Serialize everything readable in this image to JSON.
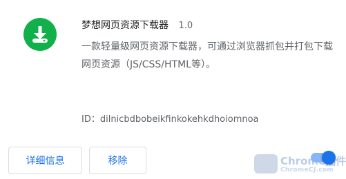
{
  "extension": {
    "name": "梦想网页资源下载器",
    "version": "1.0",
    "description": "一款轻量级网页资源下载器，可通过浏览器抓包并打包下载网页资源（JS/CSS/HTML等）。",
    "id_text": "ID：dilnicbdbobeikfinkokehkdhoiomnoa",
    "icon": "download-icon",
    "icon_color": "#12b04a"
  },
  "actions": {
    "details_label": "详细信息",
    "remove_label": "移除"
  },
  "toggle": {
    "enabled": true,
    "accent": "#1a73e8"
  },
  "watermark": {
    "brand": "Chrome插件",
    "sub": "ChromeCJ.com"
  }
}
